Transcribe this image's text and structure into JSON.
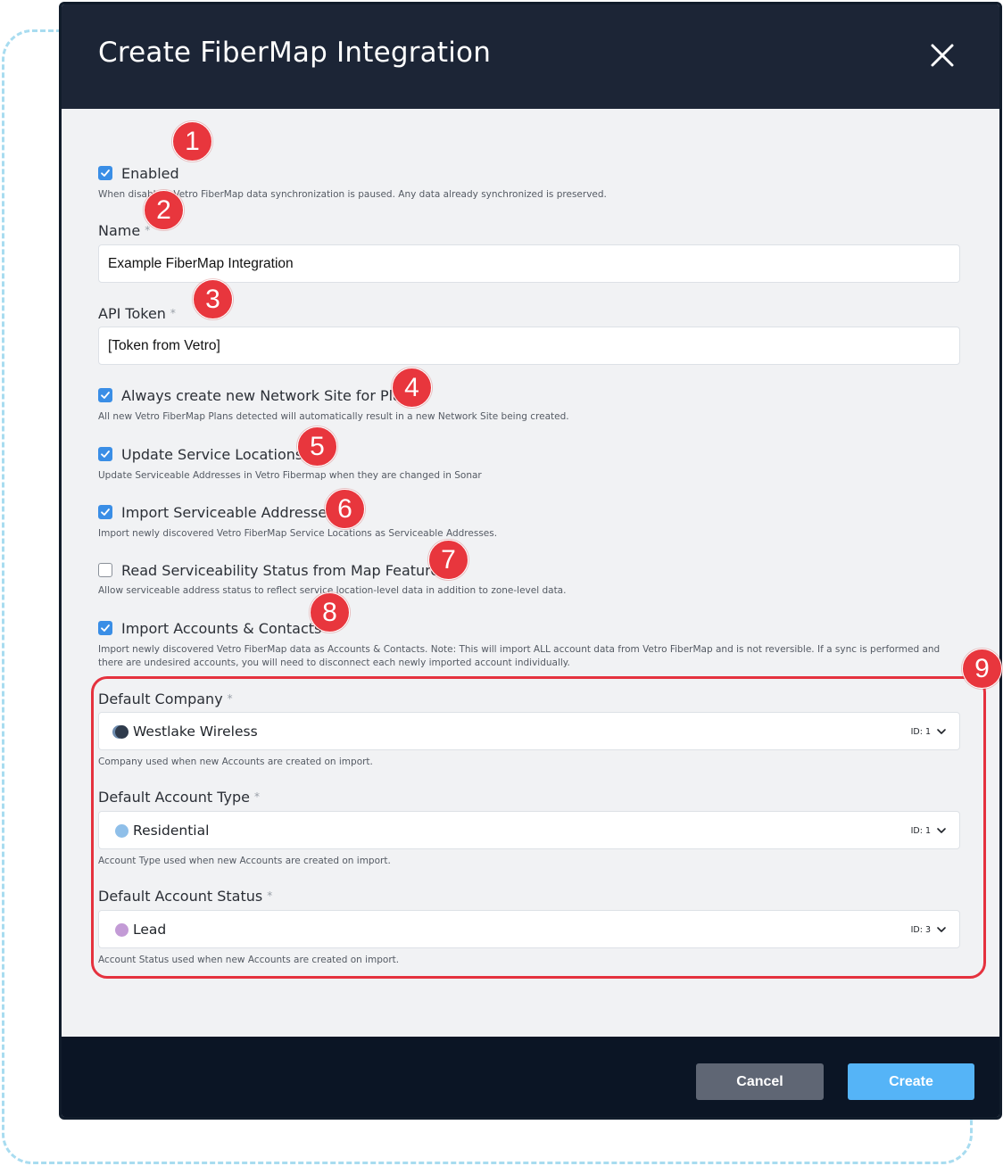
{
  "dialog": {
    "title": "Create FiberMap Integration"
  },
  "fields": {
    "enabled": {
      "label": "Enabled",
      "checked": true,
      "help": "When disabled, Vetro FiberMap data synchronization is paused. Any data already synchronized is preserved."
    },
    "name": {
      "label": "Name",
      "required_mark": "*",
      "value": "Example FiberMap Integration"
    },
    "api_token": {
      "label": "API Token",
      "required_mark": "*",
      "value": "[Token from Vetro]"
    },
    "always_create_site": {
      "label": "Always create new Network Site for Plans",
      "checked": true,
      "help": "All new Vetro FiberMap Plans detected will automatically result in a new Network Site being created."
    },
    "update_service_locations": {
      "label": "Update Service Locations",
      "checked": true,
      "help": "Update Serviceable Addresses in Vetro Fibermap when they are changed in Sonar"
    },
    "import_serviceable": {
      "label": "Import Serviceable Addresses",
      "checked": true,
      "help": "Import newly discovered Vetro FiberMap Service Locations as Serviceable Addresses."
    },
    "read_serviceability": {
      "label": "Read Serviceability Status from Map Features",
      "checked": false,
      "help": "Allow serviceable address status to reflect service location-level data in addition to zone-level data."
    },
    "import_accounts": {
      "label": "Import Accounts & Contacts",
      "checked": true,
      "help": "Import newly discovered Vetro FiberMap data as Accounts & Contacts. Note: This will import ALL account data from Vetro FiberMap and is not reversible. If a sync is performed and there are undesired accounts, you will need to disconnect each newly imported account individually."
    },
    "default_company": {
      "label": "Default Company",
      "required_mark": "*",
      "value": "Westlake Wireless",
      "id_text": "ID: 1",
      "dot_color": "#2f3b4c",
      "help": "Company used when new Accounts are created on import."
    },
    "default_account_type": {
      "label": "Default Account Type",
      "required_mark": "*",
      "value": "Residential",
      "id_text": "ID: 1",
      "dot_color": "#8fbfe9",
      "help": "Account Type used when new Accounts are created on import."
    },
    "default_account_status": {
      "label": "Default Account Status",
      "required_mark": "*",
      "value": "Lead",
      "id_text": "ID: 3",
      "dot_color": "#c39bd6",
      "help": "Account Status used when new Accounts are created on import."
    }
  },
  "badges": [
    "1",
    "2",
    "3",
    "4",
    "5",
    "6",
    "7",
    "8",
    "9"
  ],
  "footer": {
    "cancel_label": "Cancel",
    "create_label": "Create"
  },
  "colors": {
    "header_bg": "#1c2536",
    "footer_bg": "#0b1525",
    "checkbox_accent": "#3a8ee6",
    "create_button": "#55b4f7",
    "cancel_button": "#5f6674",
    "badge_red": "#e8363d",
    "highlight_outline": "#e5323e",
    "dashed_outline": "#a8dcf0"
  }
}
